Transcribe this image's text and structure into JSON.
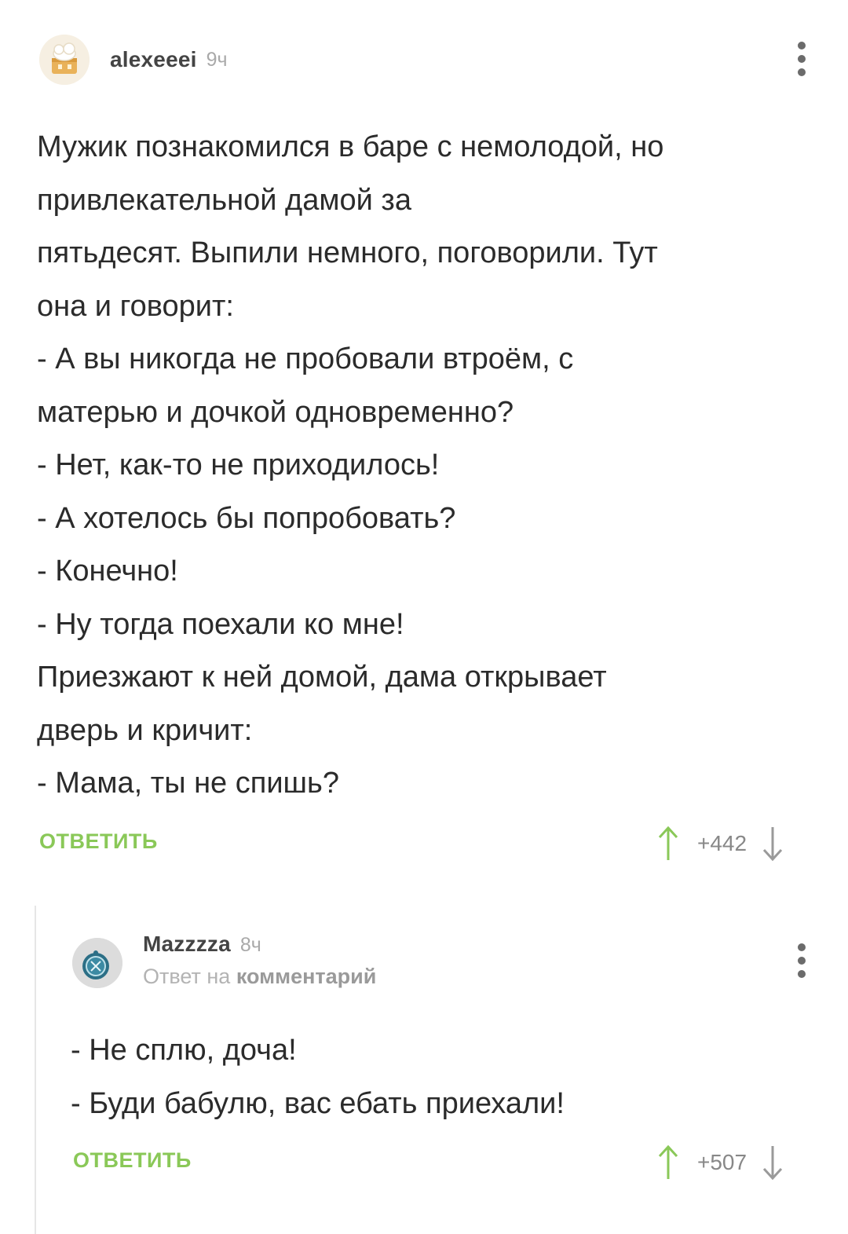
{
  "comment": {
    "author": "alexeeei",
    "time": "9ч",
    "lines": [
      "Мужик познакомился в баре с немолодой, но",
      "привлекательной дамой за",
      "пятьдесят. Выпили немного, поговорили. Тут",
      "она и говорит:",
      "- А вы никогда не пробовали втроём, с",
      "матерью и дочкой одновременно?",
      "- Нет, как-то не приходилось!",
      "- А хотелось бы попробовать?",
      "- Конечно!",
      "- Ну тогда поехали ко мне!",
      "Приезжают к ней домой, дама открывает",
      "дверь и кричит:",
      "- Мама, ты не спишь?"
    ],
    "reply_label": "ОТВЕТИТЬ",
    "rating": "+442"
  },
  "reply": {
    "author": "Mazzzza",
    "time": "8ч",
    "reply_prefix": "Ответ на",
    "reply_target": "комментарий",
    "lines": [
      "- Не сплю, доча!",
      "- Буди бабулю, вас ебать приехали!"
    ],
    "reply_label": "ОТВЕТИТЬ",
    "rating": "+507"
  },
  "colors": {
    "accent_green": "#8ac858",
    "text": "#2b2b2b",
    "muted": "#a9a9a9"
  },
  "icons": [
    "more-vertical-icon",
    "arrow-up-icon",
    "arrow-down-icon"
  ]
}
